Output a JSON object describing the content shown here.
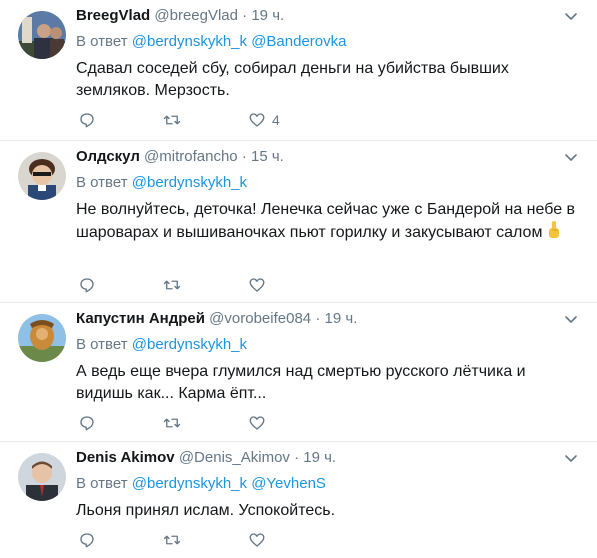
{
  "tweets": [
    {
      "name": "BreegVlad",
      "handle": "@breegVlad",
      "dot": "·",
      "time": "19 ч.",
      "reply_prefix": "В ответ",
      "reply_to": [
        "@berdynskykh_k",
        "@Banderovka"
      ],
      "text": "Сдавал соседей сбу, собирал деньги на убийства бывших земляков. Мерзость.",
      "likes": "4",
      "avatar_icon": "avatar-photo"
    },
    {
      "name": "Олдскул",
      "handle": "@mitrofancho",
      "dot": "·",
      "time": "15 ч.",
      "reply_prefix": "В ответ",
      "reply_to": [
        "@berdynskykh_k"
      ],
      "text": "Не волнуйтесь, деточка! Ленечка сейчас уже с Бандерой на небе в шароварах и вышиваночках пьют горилку и закусывают салом",
      "text_emoji": "pointing-up-hand-emoji",
      "likes": "",
      "avatar_icon": "avatar-photo"
    },
    {
      "name": "Капустин Андрей",
      "handle": "@vorobeife084",
      "dot": "·",
      "time": "19 ч.",
      "reply_prefix": "В ответ",
      "reply_to": [
        "@berdynskykh_k"
      ],
      "text": "А ведь еще вчера глумился над смертью русского лётчика и видишь как... Карма ёпт...",
      "likes": "",
      "avatar_icon": "avatar-photo"
    },
    {
      "name": "Denis Akimov",
      "handle": "@Denis_Akimov",
      "dot": "·",
      "time": "19 ч.",
      "reply_prefix": "В ответ",
      "reply_to": [
        "@berdynskykh_k",
        "@YevhenS"
      ],
      "text": "Льоня принял ислам. Успокойтесь.",
      "likes": "",
      "avatar_icon": "avatar-photo"
    }
  ],
  "colors": {
    "link": "#1b95e0",
    "muted": "#657786",
    "text": "#14171a",
    "divider": "#e6ecf0"
  },
  "icons": {
    "reply": "reply-icon",
    "retweet": "retweet-icon",
    "like": "heart-icon",
    "menu": "chevron-down-icon"
  }
}
